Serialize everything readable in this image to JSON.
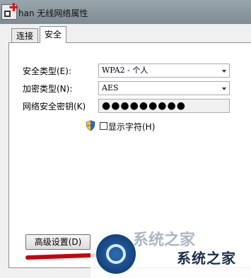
{
  "window": {
    "title": "han 无线网络属性"
  },
  "tabs": [
    {
      "label": "连接",
      "active": false
    },
    {
      "label": "安全",
      "active": true
    }
  ],
  "security": {
    "type_label": "安全类型(E):",
    "type_value": "WPA2 - 个人",
    "encryption_label": "加密类型(N):",
    "encryption_value": "AES",
    "key_label": "网络安全密钥(K)",
    "key_value": "●●●●●●●●●",
    "show_chars_label": "显示字符(H)",
    "show_chars_checked": false
  },
  "buttons": {
    "advanced_label": "高级设置(D)"
  },
  "watermark": {
    "text": "系统之家",
    "top_text": "系统之家"
  }
}
